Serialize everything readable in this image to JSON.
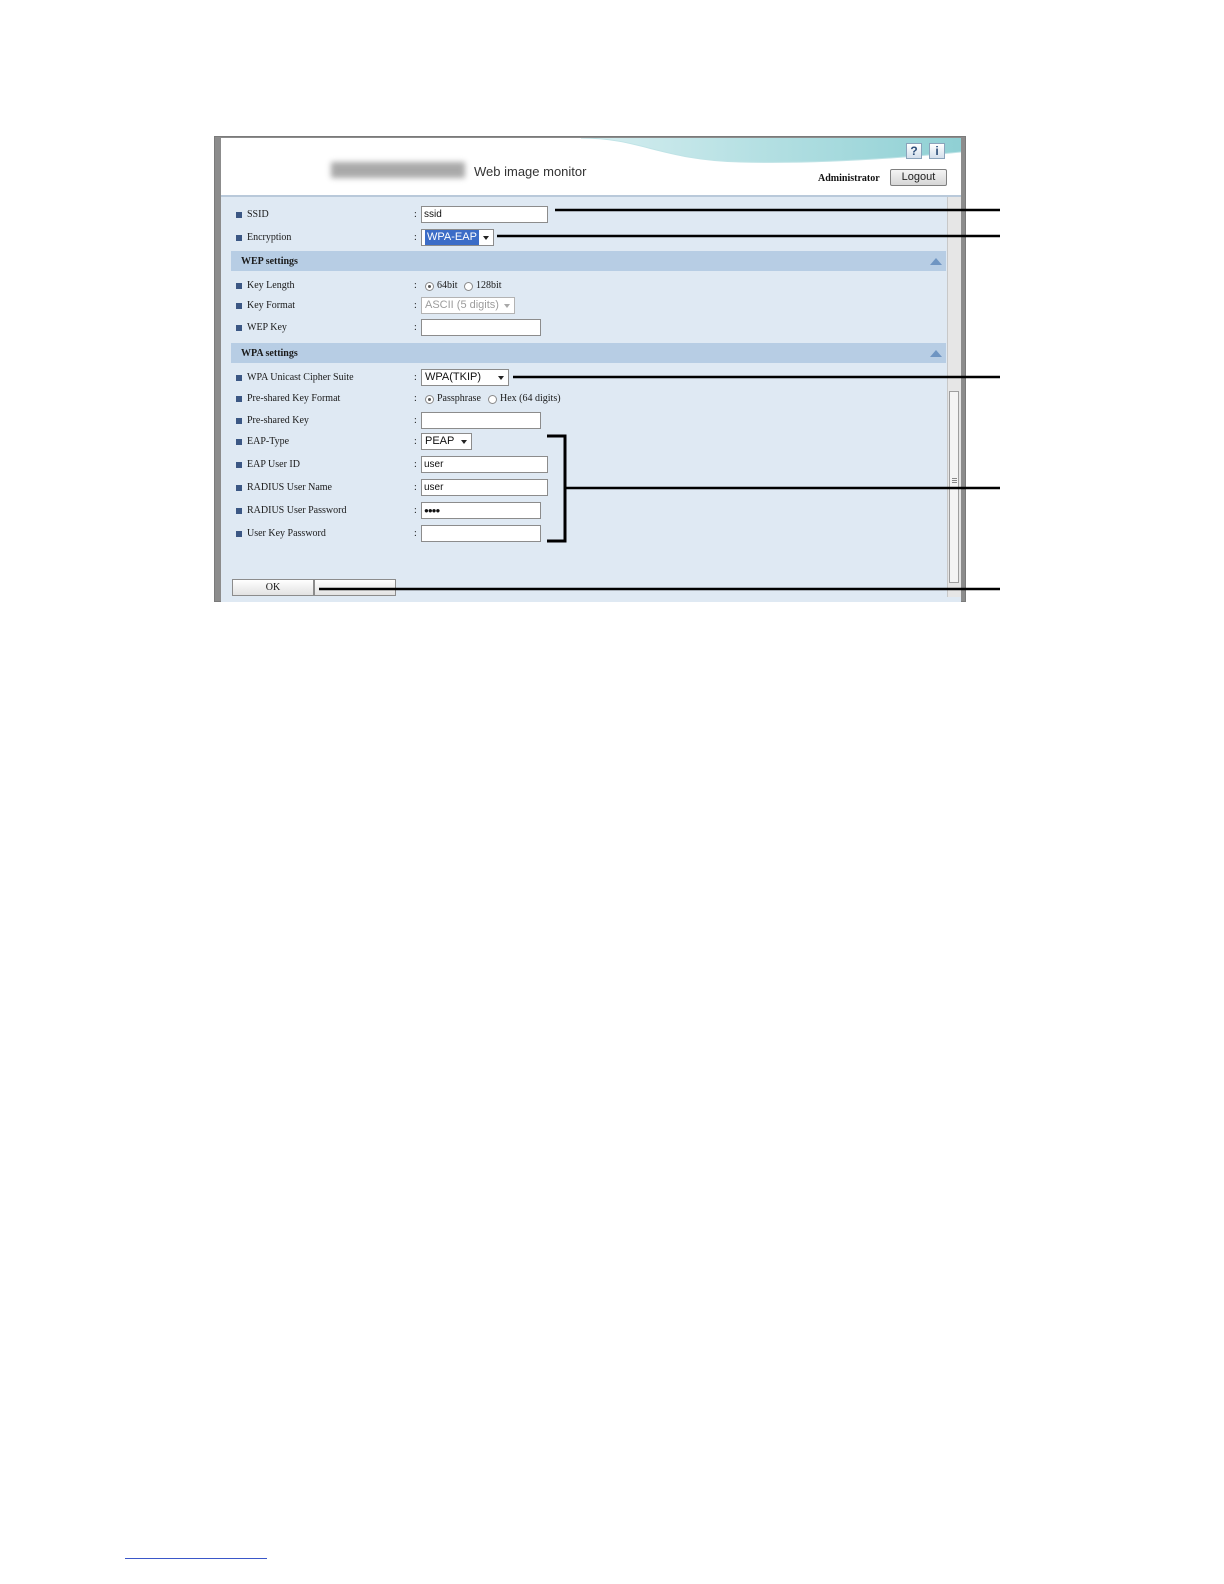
{
  "header": {
    "app_title": "Web image monitor",
    "help_icon_glyph": "?",
    "info_icon_glyph": "i",
    "user_role": "Administrator",
    "logout_label": "Logout"
  },
  "fields": {
    "ssid": {
      "label": "SSID",
      "value": "ssid"
    },
    "encryption": {
      "label": "Encryption",
      "value": "WPA-EAP"
    }
  },
  "wep": {
    "title": "WEP settings",
    "key_length": {
      "label": "Key Length",
      "option_64": "64bit",
      "option_128": "128bit",
      "selected": "64bit"
    },
    "key_format": {
      "label": "Key Format",
      "value": "ASCII (5 digits)"
    },
    "wep_key": {
      "label": "WEP Key",
      "value": ""
    }
  },
  "wpa": {
    "title": "WPA settings",
    "cipher_suite": {
      "label": "WPA Unicast Cipher Suite",
      "value": "WPA(TKIP)"
    },
    "psk_format": {
      "label": "Pre-shared Key Format",
      "option_pass": "Passphrase",
      "option_hex": "Hex (64 digits)",
      "selected": "Passphrase"
    },
    "psk": {
      "label": "Pre-shared Key",
      "value": ""
    },
    "eap_type": {
      "label": "EAP-Type",
      "value": "PEAP"
    },
    "eap_user_id": {
      "label": "EAP User ID",
      "value": "user"
    },
    "radius_user_name": {
      "label": "RADIUS User Name",
      "value": "user"
    },
    "radius_user_password": {
      "label": "RADIUS User Password",
      "value": "●●●●"
    },
    "user_key_password": {
      "label": "User Key Password",
      "value": ""
    }
  },
  "buttons": {
    "ok_label": "OK",
    "cancel_label": ""
  },
  "colon": ":",
  "colors": {
    "section_bg": "#b7cde4",
    "content_bg": "#dfe9f3",
    "bullet": "#3b5784",
    "highlight": "#3b6cc7"
  },
  "icons": [
    "help-icon",
    "info-icon",
    "collapse-icon",
    "dropdown-arrow-icon"
  ]
}
